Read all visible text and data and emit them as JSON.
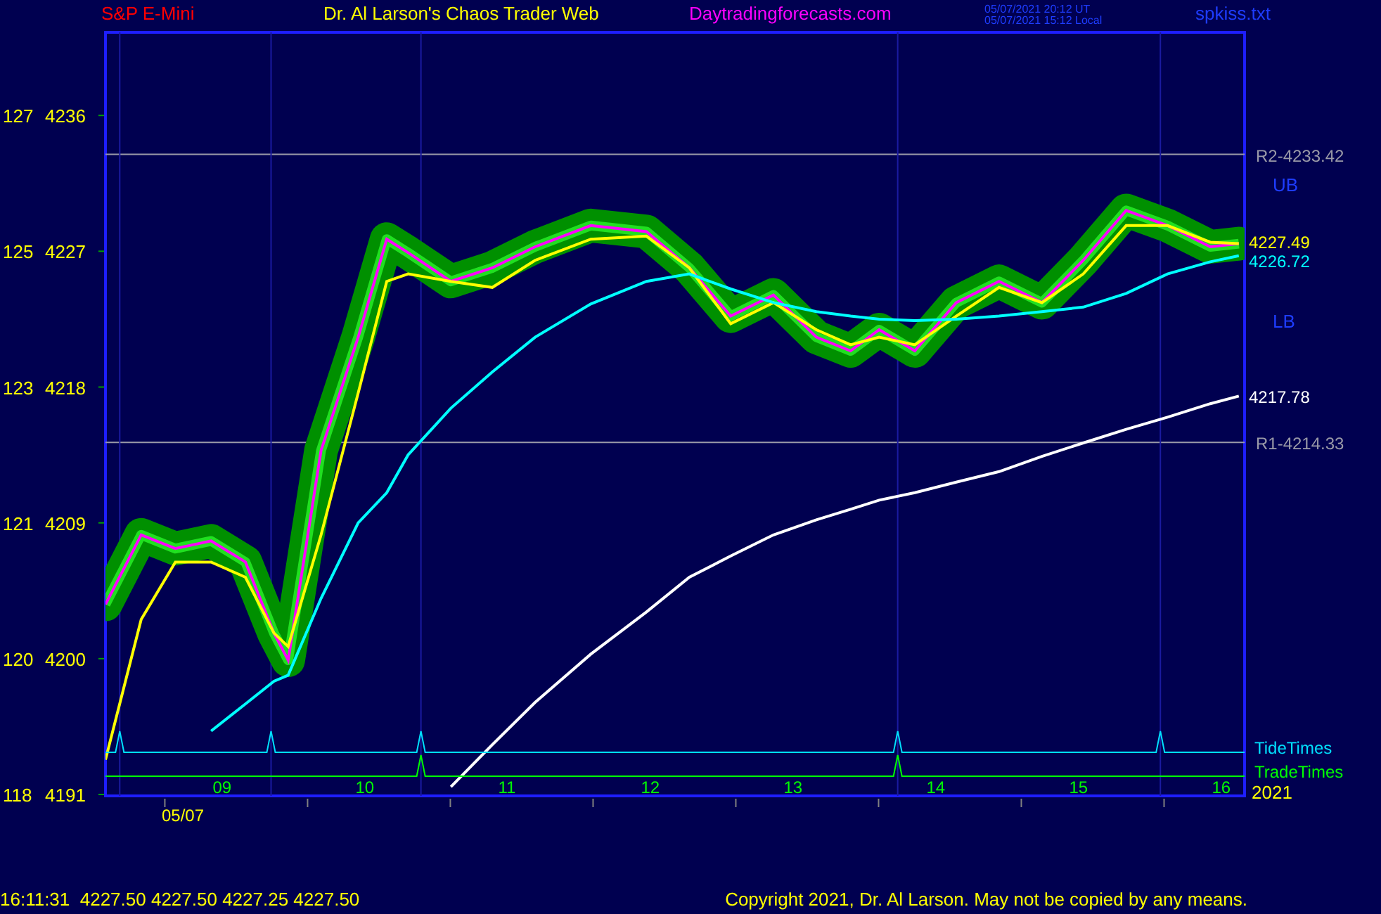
{
  "header": {
    "symbol": "S&P E-Mini",
    "site_title": "Dr. Al Larson's Chaos Trader Web",
    "site_link": "Daytradingforecasts.com",
    "timestamps": [
      "05/07/2021 20:12 UT",
      "05/07/2021 15:12 Local"
    ],
    "file": "spkiss.txt"
  },
  "chart": {
    "chart_data": {
      "type": "line",
      "xlim": [
        8.19,
        16.17
      ],
      "ylim": [
        4191,
        4241.6
      ],
      "x": [
        8.19,
        8.44,
        8.68,
        8.93,
        9.17,
        9.37,
        9.47,
        9.7,
        9.96,
        10.16,
        10.31,
        10.61,
        10.9,
        11.2,
        11.59,
        11.98,
        12.28,
        12.57,
        12.87,
        13.17,
        13.41,
        13.61,
        13.86,
        14.15,
        14.45,
        14.75,
        15.04,
        15.34,
        15.63,
        15.93,
        16.13
      ],
      "series": [
        {
          "color": "#ff00ff",
          "values": [
            4203.6,
            4208.2,
            4207.3,
            4207.8,
            4206.4,
            4201.7,
            4199.9,
            4213.8,
            4221.3,
            4227.8,
            4226.9,
            4225.0,
            4225.9,
            4227.3,
            4228.7,
            4228.3,
            4225.9,
            4222.7,
            4224.1,
            4221.3,
            4220.4,
            4221.8,
            4220.4,
            4223.6,
            4225.0,
            4223.6,
            4226.4,
            4229.7,
            4228.7,
            4227.3,
            4227.5
          ]
        },
        {
          "color": "#ffff00",
          "values": [
            4193.3,
            4202.6,
            4206.4,
            4206.4,
            4205.4,
            4201.7,
            4200.8,
            4208.2,
            4217.6,
            4225.0,
            4225.5,
            4225.0,
            4224.6,
            4226.4,
            4227.8,
            4228.0,
            4225.9,
            4222.2,
            4223.6,
            4221.8,
            4220.8,
            4221.3,
            4220.8,
            4222.7,
            4224.6,
            4223.6,
            4225.5,
            4228.7,
            4228.7,
            4227.6,
            4227.5
          ]
        },
        {
          "color": "#00ffff",
          "values": [
            null,
            null,
            null,
            4195.2,
            4197.0,
            4198.5,
            4198.9,
            4204.0,
            4209.0,
            4211.0,
            4213.5,
            4216.6,
            4219.0,
            4221.3,
            4223.5,
            4225.0,
            4225.5,
            4224.5,
            4223.6,
            4223.0,
            4222.7,
            4222.5,
            4222.4,
            4222.5,
            4222.7,
            4223.0,
            4223.3,
            4224.2,
            4225.5,
            4226.3,
            4226.7
          ]
        },
        {
          "color": "#ffffff",
          "values": [
            null,
            null,
            null,
            null,
            null,
            null,
            null,
            null,
            null,
            null,
            null,
            4191.5,
            4194.3,
            4197.1,
            4200.3,
            4203.1,
            4205.4,
            4206.8,
            4208.2,
            4209.2,
            4209.9,
            4210.5,
            4211.0,
            4211.7,
            4212.4,
            4213.4,
            4214.3,
            4215.2,
            4216.0,
            4216.9,
            4217.4
          ]
        }
      ],
      "xticks": [
        {
          "value": 9,
          "label": "09"
        },
        {
          "value": 10,
          "label": "10"
        },
        {
          "value": 11,
          "label": "11"
        },
        {
          "value": 12,
          "label": "12"
        },
        {
          "value": 13,
          "label": "13"
        },
        {
          "value": 14,
          "label": "14"
        },
        {
          "value": 15,
          "label": "15"
        },
        {
          "value": 16,
          "label": "16"
        }
      ],
      "yticks": [
        4236,
        4227,
        4218,
        4209,
        4200,
        4191
      ],
      "ref_lines": [
        {
          "axis": "y",
          "value": 4233.42,
          "label": "R2-4233.42"
        },
        {
          "axis": "y",
          "value": 4214.33,
          "label": "R1-4214.33"
        },
        {
          "axis": "x",
          "value": 8.29
        },
        {
          "axis": "x",
          "value": 9.35
        },
        {
          "axis": "x",
          "value": 10.4
        },
        {
          "axis": "x",
          "value": 13.74
        },
        {
          "axis": "x",
          "value": 15.58
        }
      ]
    },
    "secondary_ticks": [
      "127",
      "125",
      "123",
      "121",
      "120",
      "118"
    ],
    "band_labels": [
      "UB",
      "LB"
    ],
    "end_labels": [
      {
        "text": "4227.49",
        "color": "#ffff00"
      },
      {
        "text": "4226.72",
        "color": "#00ffff"
      },
      {
        "text": "4217.78",
        "color": "#ffffff"
      }
    ],
    "event_rows": [
      {
        "label": "TideTimes",
        "color": "#00e0ff"
      },
      {
        "label": "TradeTimes",
        "color": "#00ff00"
      }
    ],
    "date_label": "05/07",
    "year_label": "2021"
  },
  "footer": {
    "quote": "16:11:31  4227.50 4227.50 4227.25 4227.50",
    "copyright": "Copyright 2021, Dr. Al Larson. May not be copied by any means."
  }
}
